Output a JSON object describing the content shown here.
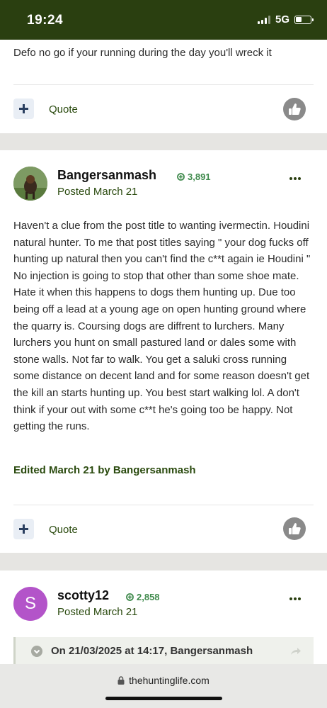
{
  "status_bar": {
    "time": "19:24",
    "network": "5G"
  },
  "posts": [
    {
      "body": "Defo no go if your running during the day you'll wreck it",
      "quote_label": "Quote"
    },
    {
      "author": "Bangersanmash",
      "reputation": "3,891",
      "posted": "Posted March 21",
      "body": "Haven't  a clue from the post title to wanting ivermectin. Houdini natural hunter. To me that post titles saying \" your dog fucks off hunting up natural then you can't find the c**t again ie Houdini \" No injection is going to stop that other than some shoe mate. Hate it when this happens to dogs them hunting up. Due too being off a lead at a young age on open hunting ground where the quarry is. Coursing dogs are diffrent to lurchers. Many lurchers you hunt on small pastured land or dales some with stone walls. Not far to walk. You get a saluki cross running some distance on decent land and for some reason doesn't get the kill an starts hunting up. You best start walking lol. A don't think if your out with some c**t he's going too be happy. Not getting the runs.",
      "edited": "Edited March 21 by Bangersanmash",
      "quote_label": "Quote"
    },
    {
      "author": "scotty12",
      "avatar_letter": "S",
      "reputation": "2,858",
      "posted": "Posted March 21",
      "quoted_header": "On 21/03/2025 at 14:17, Bangersanmash"
    }
  ],
  "browser": {
    "url": "thehuntinglife.com"
  },
  "colors": {
    "brand_dark": "#2a3f10",
    "link_green": "#2a4a0e",
    "rep_green": "#3f8a4c",
    "avatar_purple": "#b354c9"
  },
  "icons": [
    "plus-icon",
    "thumbs-up-icon",
    "more-icon",
    "reputation-plus-icon",
    "chevron-down-icon",
    "share-arrow-icon",
    "lock-icon"
  ]
}
